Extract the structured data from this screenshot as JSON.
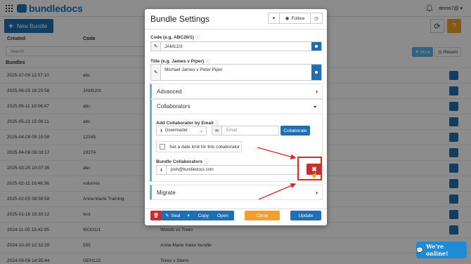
{
  "header": {
    "logo_text": "bundledocs",
    "user_label": "demo7@ ▾"
  },
  "toolbar": {
    "new_bundle_label": "New Bundle",
    "refresh_icon": "refresh-icon",
    "help_icon": "question-icon"
  },
  "table": {
    "columns": [
      "Created",
      "Code"
    ],
    "search_placeholder": "search",
    "filter_mine": "Mine",
    "filter_recent": "Recent",
    "section_label": "Bundles",
    "rows": [
      {
        "created": "2025-07-09 11:07:10",
        "code": "abc",
        "title": ""
      },
      {
        "created": "2025-06-25 16:25:58",
        "code": "JAM12/3",
        "title": ""
      },
      {
        "created": "2025-06-11 10:06:47",
        "code": "abc",
        "title": ""
      },
      {
        "created": "2025-05-21 15:06:11",
        "code": "abc",
        "title": ""
      },
      {
        "created": "2025-04-09 09:10:58",
        "code": "12345",
        "title": ""
      },
      {
        "created": "2025-04-08 09:03:17",
        "code": "19274",
        "title": ""
      },
      {
        "created": "2025-03-25 10:07:35",
        "code": "abc",
        "title": ""
      },
      {
        "created": "2025-02-11 16:46:36",
        "code": "volumes",
        "title": ""
      },
      {
        "created": "2025-02-05 08:56:58",
        "code": "Anne-Marie Training",
        "title": ""
      },
      {
        "created": "2025-01-16 16:30:12",
        "code": "test",
        "title": ""
      },
      {
        "created": "2024-11-05 15:42:05",
        "code": "WOO1/1",
        "title": "Woods vs Trees"
      },
      {
        "created": "2024-10-30 12:32:20",
        "code": "555",
        "title": "Anne-Marie Index bundle"
      },
      {
        "created": "2024-09-09 14:35:44",
        "code": "GEH123",
        "title": "Trees v Storm"
      }
    ]
  },
  "modal": {
    "title": "Bundle Settings",
    "pin_icon": "pin-icon",
    "follow_label": "Follow",
    "code_label": "Code (e.g. ABC20/1)",
    "code_value": "JAM12/3",
    "title_label": "Title (e.g. James v Piper)",
    "title_value": "Michael James v Peter Piper",
    "advanced_label": "Advanced",
    "collaborators_label": "Collaborators",
    "add_collaborator_label": "Add Collaborator by Email",
    "role_select": "Downloader",
    "email_placeholder": "Email",
    "collaborate_button": "Collaborate",
    "date_limit_label": "Set a date limit for this collaborator",
    "bundle_collaborators_label": "Bundle Collaborators",
    "collaborator_email": "josh@bundledocs.com",
    "migrate_label": "Migrate",
    "seal_label": "Seal",
    "copy_label": "Copy",
    "open_label": "Open",
    "close_label": "Close",
    "update_label": "Update"
  },
  "chat": {
    "label": "We're online!"
  },
  "colors": {
    "primary": "#1f6fb2",
    "accent": "#5bb4e5",
    "danger": "#c62f2f",
    "warning": "#f0a030",
    "annotation": "#e02525"
  }
}
